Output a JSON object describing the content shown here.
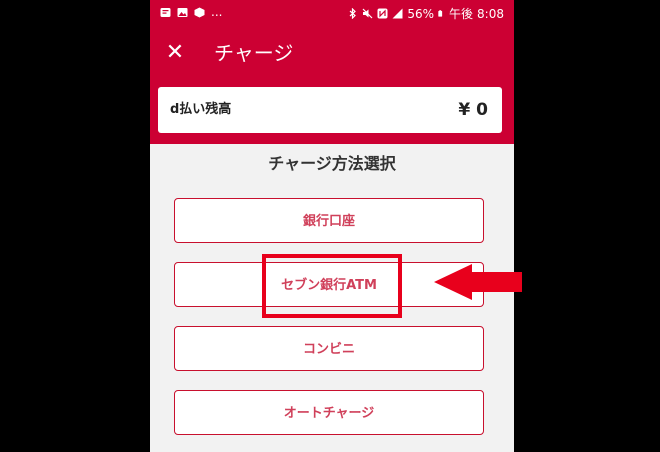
{
  "status_bar": {
    "battery": "56%",
    "time_period": "午後",
    "time": "8:08",
    "more": "..."
  },
  "header": {
    "title": "チャージ",
    "close_symbol": "✕"
  },
  "balance": {
    "label": "d払い残高",
    "value": "¥ 0"
  },
  "section_title": "チャージ方法選択",
  "options": [
    {
      "label": "銀行口座"
    },
    {
      "label": "セブン銀行ATM"
    },
    {
      "label": "コンビニ"
    },
    {
      "label": "オートチャージ"
    }
  ],
  "colors": {
    "brand": "#cc0033",
    "highlight": "#e8001c",
    "button_text": "#d0405a",
    "background": "#f2f2f2"
  },
  "icons": {
    "status_left": [
      "notification-icon",
      "gallery-icon",
      "app-icon"
    ],
    "status_right": [
      "bluetooth-icon",
      "mute-icon",
      "nfc-icon",
      "signal-icon",
      "battery-icon"
    ],
    "close": "close-icon",
    "annotation": "arrow-left-icon"
  }
}
